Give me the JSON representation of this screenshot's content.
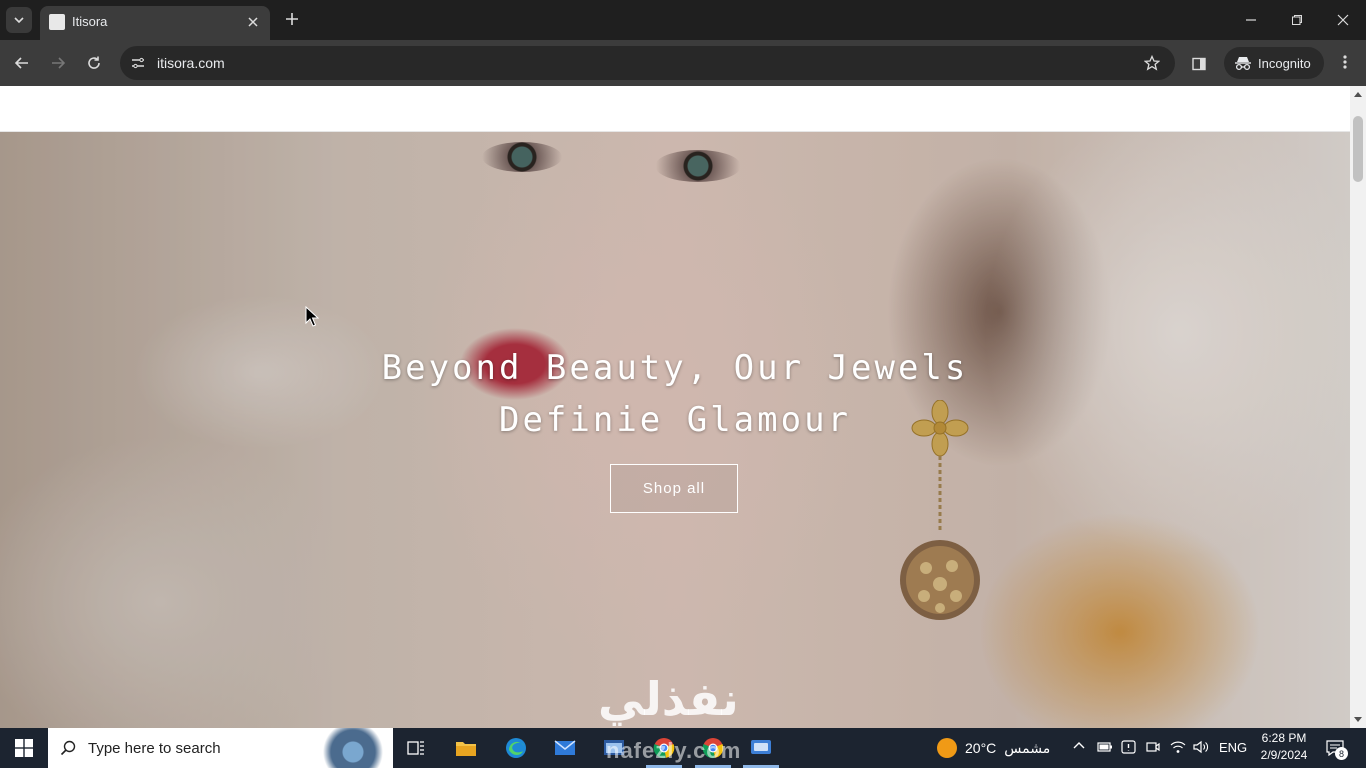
{
  "browser": {
    "tab": {
      "title": "Itisora"
    },
    "url": "itisora.com",
    "incognito_label": "Incognito"
  },
  "hero": {
    "title_line1": "Beyond Beauty, Our Jewels",
    "title_line2": "Definie Glamour",
    "button_label": "Shop all",
    "watermark": "نفذلي"
  },
  "taskbar": {
    "search_placeholder": "Type here to search",
    "weather_temp": "20°C",
    "weather_text": "مشمس",
    "language": "ENG",
    "time": "6:28 PM",
    "date": "2/9/2024",
    "notification_count": "8",
    "watermark_text": "nafezly.com"
  },
  "colors": {
    "browser_bg": "#1f1f1f",
    "toolbar_bg": "#3c3c3c",
    "taskbar_bg": "#1c2430",
    "sun": "#f09a16"
  }
}
